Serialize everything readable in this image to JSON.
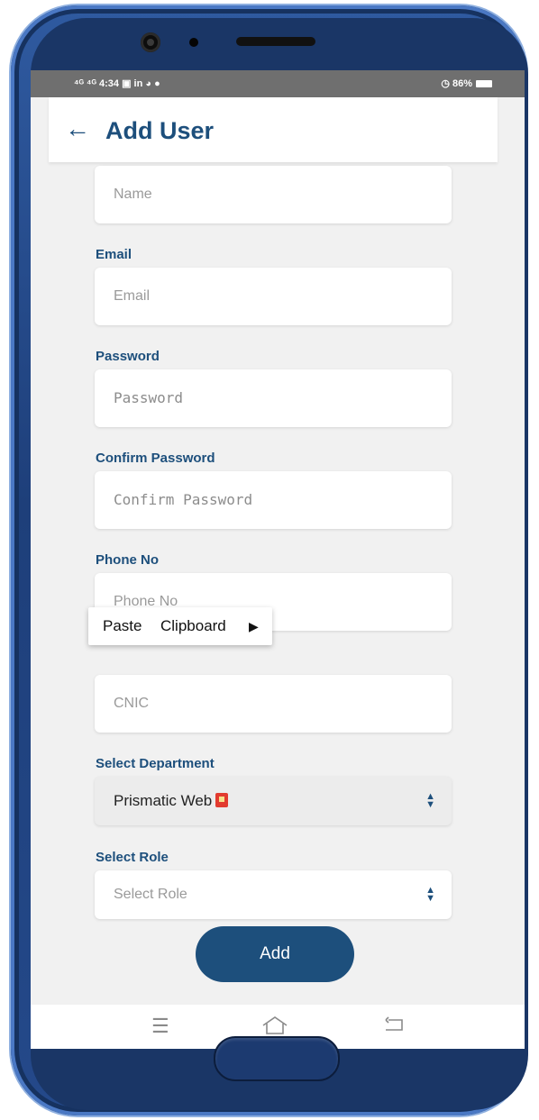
{
  "status_bar": {
    "left_text": "⁴ᴳ ⁴ᴳ 4:34 ▣ in ◕ ●",
    "right_text": "◷ 86%"
  },
  "app_bar": {
    "back_icon": "arrow-left-icon",
    "title": "Add User"
  },
  "form": {
    "name": {
      "placeholder": "Name"
    },
    "email": {
      "label": "Email",
      "placeholder": "Email"
    },
    "password": {
      "label": "Password",
      "placeholder": "Password"
    },
    "confirm_password": {
      "label": "Confirm Password",
      "placeholder": "Confirm Password"
    },
    "phone": {
      "label": "Phone No",
      "placeholder": "Phone No"
    },
    "cnic": {
      "placeholder": "CNIC"
    },
    "department": {
      "label": "Select Department",
      "value": "Prismatic Web"
    },
    "role": {
      "label": "Select Role",
      "placeholder": "Select Role"
    },
    "submit_label": "Add"
  },
  "context_menu": {
    "paste": "Paste",
    "clipboard": "Clipboard"
  },
  "nav_bar": {
    "menu_icon": "menu-icon",
    "home_icon": "home-icon",
    "back_icon": "back-icon"
  },
  "colors": {
    "accent": "#1d4f7c",
    "background": "#f1f1f1",
    "frame": "#24498a"
  }
}
